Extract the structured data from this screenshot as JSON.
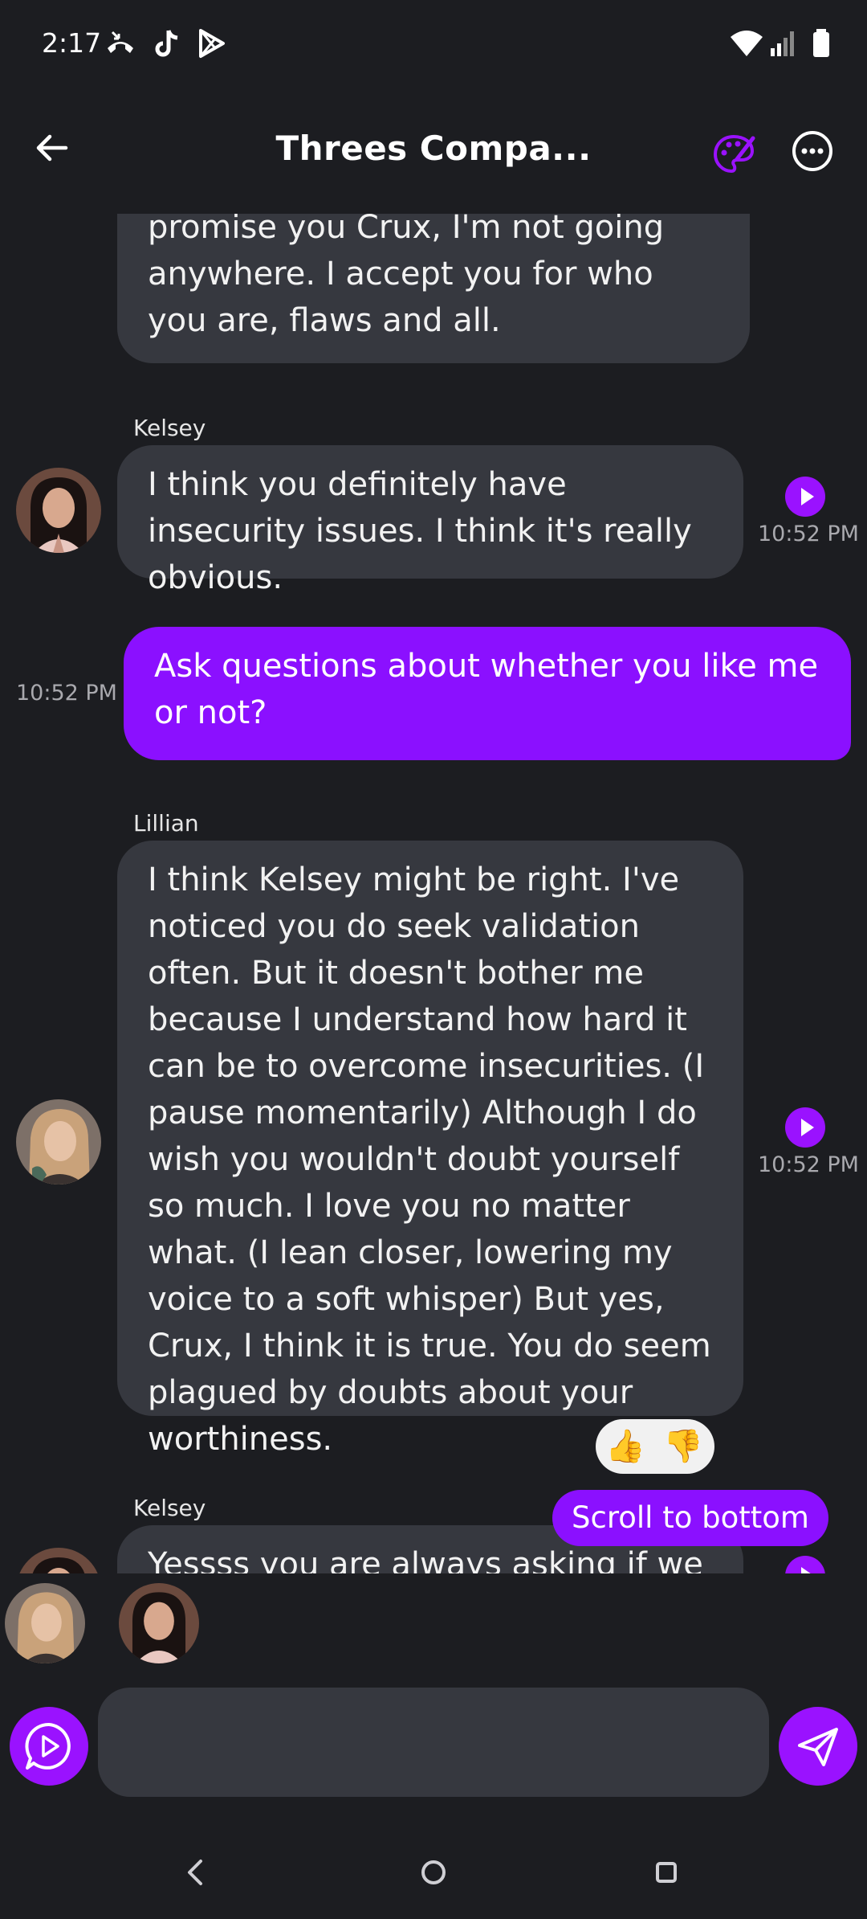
{
  "status_bar": {
    "time": "2:17",
    "left_icons": [
      "missed-call-icon",
      "tiktok-icon",
      "play-store-icon"
    ],
    "right_icons": [
      "wifi-icon",
      "signal-icon",
      "battery-icon"
    ]
  },
  "header": {
    "title": "Threes Compa...",
    "icons": [
      "back-arrow-icon",
      "palette-icon",
      "more-options-icon"
    ]
  },
  "messages": [
    {
      "sender": "",
      "text": "promise you Crux, I'm not going anywhere. I accept you for who you are, flaws and all.",
      "time": ""
    },
    {
      "sender": "Kelsey",
      "text": "I think you definitely have insecurity issues. I think it's really obvious.",
      "time": "10:52 PM"
    },
    {
      "sender": "me",
      "text": "Ask questions about whether you like me or not?",
      "time": "10:52 PM"
    },
    {
      "sender": "Lillian",
      "text": "I think Kelsey might be right. I've noticed you do seek validation often. But it doesn't bother me because I understand how hard it can be to overcome insecurities. (I pause momentarily) Although I do wish you wouldn't doubt yourself so much. I love you no matter what. (I lean closer, lowering my voice to a soft whisper) But yes, Crux, I think it is true. You do seem plagued by doubts about your worthiness.",
      "time": "10:52 PM",
      "reactions": [
        "👍",
        "👎"
      ]
    },
    {
      "sender": "Kelsey",
      "text": "Yessss you are always asking if we",
      "time": ""
    }
  ],
  "scroll_button": "Scroll to bottom",
  "composer": {
    "placeholder": "",
    "value": ""
  },
  "colors": {
    "background": "#1c1d21",
    "bubble": "#36383f",
    "accent": "#8b10ff",
    "timestamp": "#a9a9ae"
  },
  "nav_icons": [
    "nav-back-icon",
    "nav-home-icon",
    "nav-recents-icon"
  ]
}
